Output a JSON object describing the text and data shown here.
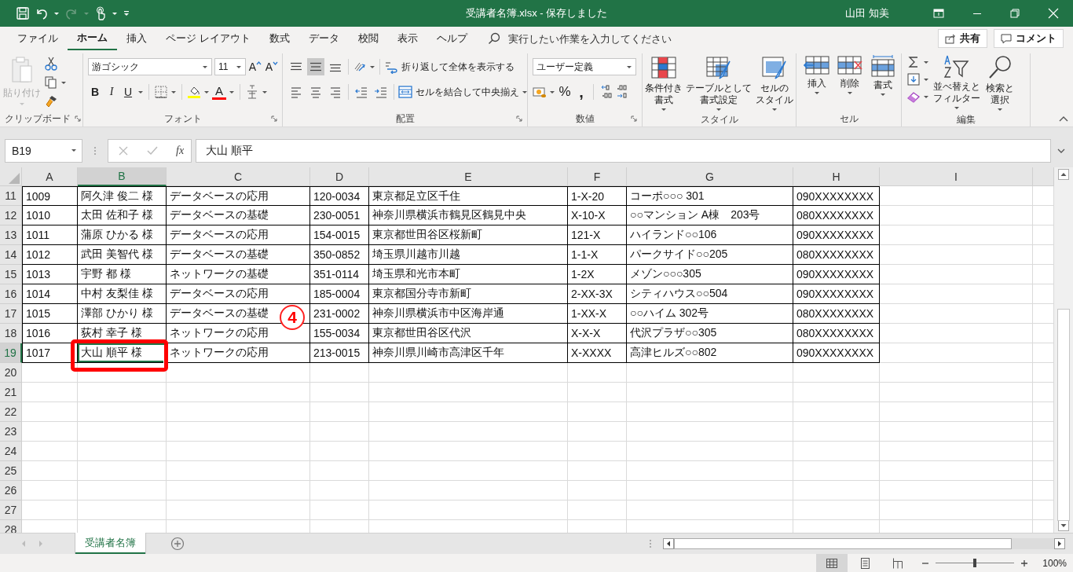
{
  "title_bar": {
    "title": "受講者名簿.xlsx  -  保存しました",
    "user": "山田 知美"
  },
  "ribbon_tabs": [
    {
      "label": "ファイル",
      "selected": false
    },
    {
      "label": "ホーム",
      "selected": true
    },
    {
      "label": "挿入",
      "selected": false
    },
    {
      "label": "ページ レイアウト",
      "selected": false
    },
    {
      "label": "数式",
      "selected": false
    },
    {
      "label": "データ",
      "selected": false
    },
    {
      "label": "校閲",
      "selected": false
    },
    {
      "label": "表示",
      "selected": false
    },
    {
      "label": "ヘルプ",
      "selected": false
    }
  ],
  "tell_me": {
    "placeholder": "実行したい作業を入力してください"
  },
  "share_button": "共有",
  "comment_button": "コメント",
  "ribbon": {
    "groups": [
      {
        "kind": "clipboard",
        "label": "クリップボード",
        "launcher": true,
        "paste": {
          "label": "貼り付け",
          "disabled": true
        }
      },
      {
        "kind": "font",
        "label": "フォント",
        "launcher": true,
        "font_name": "游ゴシック",
        "font_size": "11",
        "size_buttons": [
          {
            "kind": "grow",
            "label": "A"
          },
          {
            "kind": "shrink",
            "label": "A"
          }
        ],
        "style_buttons": [
          "B",
          "I",
          "U"
        ],
        "font_color_label": "A"
      },
      {
        "kind": "alignment",
        "label": "配置",
        "launcher": true,
        "vertical_align": [
          {
            "selected": false
          },
          {
            "selected": true
          },
          {
            "selected": false
          }
        ],
        "wrap_text": "折り返して全体を表示する",
        "merge": "セルを結合して中央揃え"
      },
      {
        "kind": "number",
        "label": "数値",
        "launcher": true,
        "format": "ユーザー定義",
        "symbols": [
          "%",
          ","
        ]
      },
      {
        "kind": "styles",
        "label": "スタイル",
        "launcher": false,
        "buttons": [
          {
            "kind": "conditional",
            "lines": [
              "条件付き",
              "書式"
            ]
          },
          {
            "kind": "table",
            "lines": [
              "テーブルとして",
              "書式設定"
            ]
          },
          {
            "kind": "cellstyle",
            "lines": [
              "セルの",
              "スタイル"
            ]
          }
        ]
      },
      {
        "kind": "cells",
        "label": "セル",
        "launcher": false,
        "buttons": [
          {
            "kind": "insert",
            "lines": [
              "挿入"
            ]
          },
          {
            "kind": "delete",
            "lines": [
              "削除"
            ]
          },
          {
            "kind": "format",
            "lines": [
              "書式"
            ]
          }
        ]
      },
      {
        "kind": "editing",
        "label": "編集",
        "launcher": false,
        "buttons": [
          {
            "kind": "sort",
            "lines": [
              "並べ替えと",
              "フィルター"
            ]
          },
          {
            "kind": "find",
            "lines": [
              "検索と",
              "選択"
            ]
          }
        ]
      }
    ]
  },
  "formula_bar": {
    "name_box": "B19",
    "function_label": "fx",
    "content": "大山 順平"
  },
  "sheet": {
    "columns": [
      {
        "label": "A",
        "selected": false
      },
      {
        "label": "B",
        "selected": true
      },
      {
        "label": "C",
        "selected": false
      },
      {
        "label": "D",
        "selected": false
      },
      {
        "label": "E",
        "selected": false
      },
      {
        "label": "F",
        "selected": false
      },
      {
        "label": "G",
        "selected": false
      },
      {
        "label": "H",
        "selected": false
      },
      {
        "label": "I",
        "selected": false
      }
    ],
    "rows": [
      {
        "number": "11",
        "selected": false,
        "cells": [
          "1009",
          "阿久津 俊二 様",
          "データベースの応用",
          "120-0034",
          "東京都足立区千住",
          "1-X-20",
          "コーポ○○○ 301",
          "090XXXXXXXX"
        ]
      },
      {
        "number": "12",
        "selected": false,
        "cells": [
          "1010",
          "太田 佐和子 様",
          "データベースの基礎",
          "230-0051",
          "神奈川県横浜市鶴見区鶴見中央",
          "X-10-X",
          "○○マンション A棟　203号",
          "080XXXXXXXX"
        ]
      },
      {
        "number": "13",
        "selected": false,
        "cells": [
          "1011",
          "蒲原 ひかる 様",
          "データベースの応用",
          "154-0015",
          "東京都世田谷区桜新町",
          "121-X",
          "ハイランド○○106",
          "090XXXXXXXX"
        ]
      },
      {
        "number": "14",
        "selected": false,
        "cells": [
          "1012",
          "武田 美智代 様",
          "データベースの基礎",
          "350-0852",
          "埼玉県川越市川越",
          "1-1-X",
          "パークサイド○○205",
          "080XXXXXXXX"
        ]
      },
      {
        "number": "15",
        "selected": false,
        "cells": [
          "1013",
          "宇野 都 様",
          "ネットワークの基礎",
          "351-0114",
          "埼玉県和光市本町",
          "1-2X",
          "メゾン○○○305",
          "090XXXXXXXX"
        ]
      },
      {
        "number": "16",
        "selected": false,
        "cells": [
          "1014",
          "中村 友梨佳 様",
          "データベースの応用",
          "185-0004",
          "東京都国分寺市新町",
          "2-XX-3X",
          "シティハウス○○504",
          "090XXXXXXXX"
        ]
      },
      {
        "number": "17",
        "selected": false,
        "cells": [
          "1015",
          "澤部 ひかり 様",
          "データベースの基礎",
          "231-0002",
          "神奈川県横浜市中区海岸通",
          "1-XX-X",
          "○○ハイム 302号",
          "080XXXXXXXX"
        ]
      },
      {
        "number": "18",
        "selected": false,
        "cells": [
          "1016",
          "荻村 幸子 様",
          "ネットワークの応用",
          "155-0034",
          "東京都世田谷区代沢",
          "X-X-X",
          "代沢プラザ○○305",
          "080XXXXXXXX"
        ]
      },
      {
        "number": "19",
        "selected": true,
        "cells": [
          "1017",
          "大山 順平 様",
          "ネットワークの応用",
          "213-0015",
          "神奈川県川崎市高津区千年",
          "X-XXXX",
          "高津ヒルズ○○802",
          "090XXXXXXXX"
        ]
      },
      {
        "number": "20",
        "selected": false,
        "cells": []
      },
      {
        "number": "21",
        "selected": false,
        "cells": []
      },
      {
        "number": "22",
        "selected": false,
        "cells": []
      },
      {
        "number": "23",
        "selected": false,
        "cells": []
      },
      {
        "number": "24",
        "selected": false,
        "cells": []
      },
      {
        "number": "25",
        "selected": false,
        "cells": []
      },
      {
        "number": "26",
        "selected": false,
        "cells": []
      },
      {
        "number": "27",
        "selected": false,
        "cells": []
      },
      {
        "number": "28",
        "selected": false,
        "cells": []
      }
    ]
  },
  "annotation": {
    "step": "4"
  },
  "sheet_tabs": [
    {
      "label": "受講者名簿",
      "selected": true
    }
  ],
  "status_bar": {
    "views": [
      {
        "kind": "normal",
        "selected": true
      },
      {
        "kind": "layout",
        "selected": false
      },
      {
        "kind": "pagebreak",
        "selected": false
      }
    ],
    "zoom": {
      "level": 0.5,
      "reading": "100%"
    }
  }
}
